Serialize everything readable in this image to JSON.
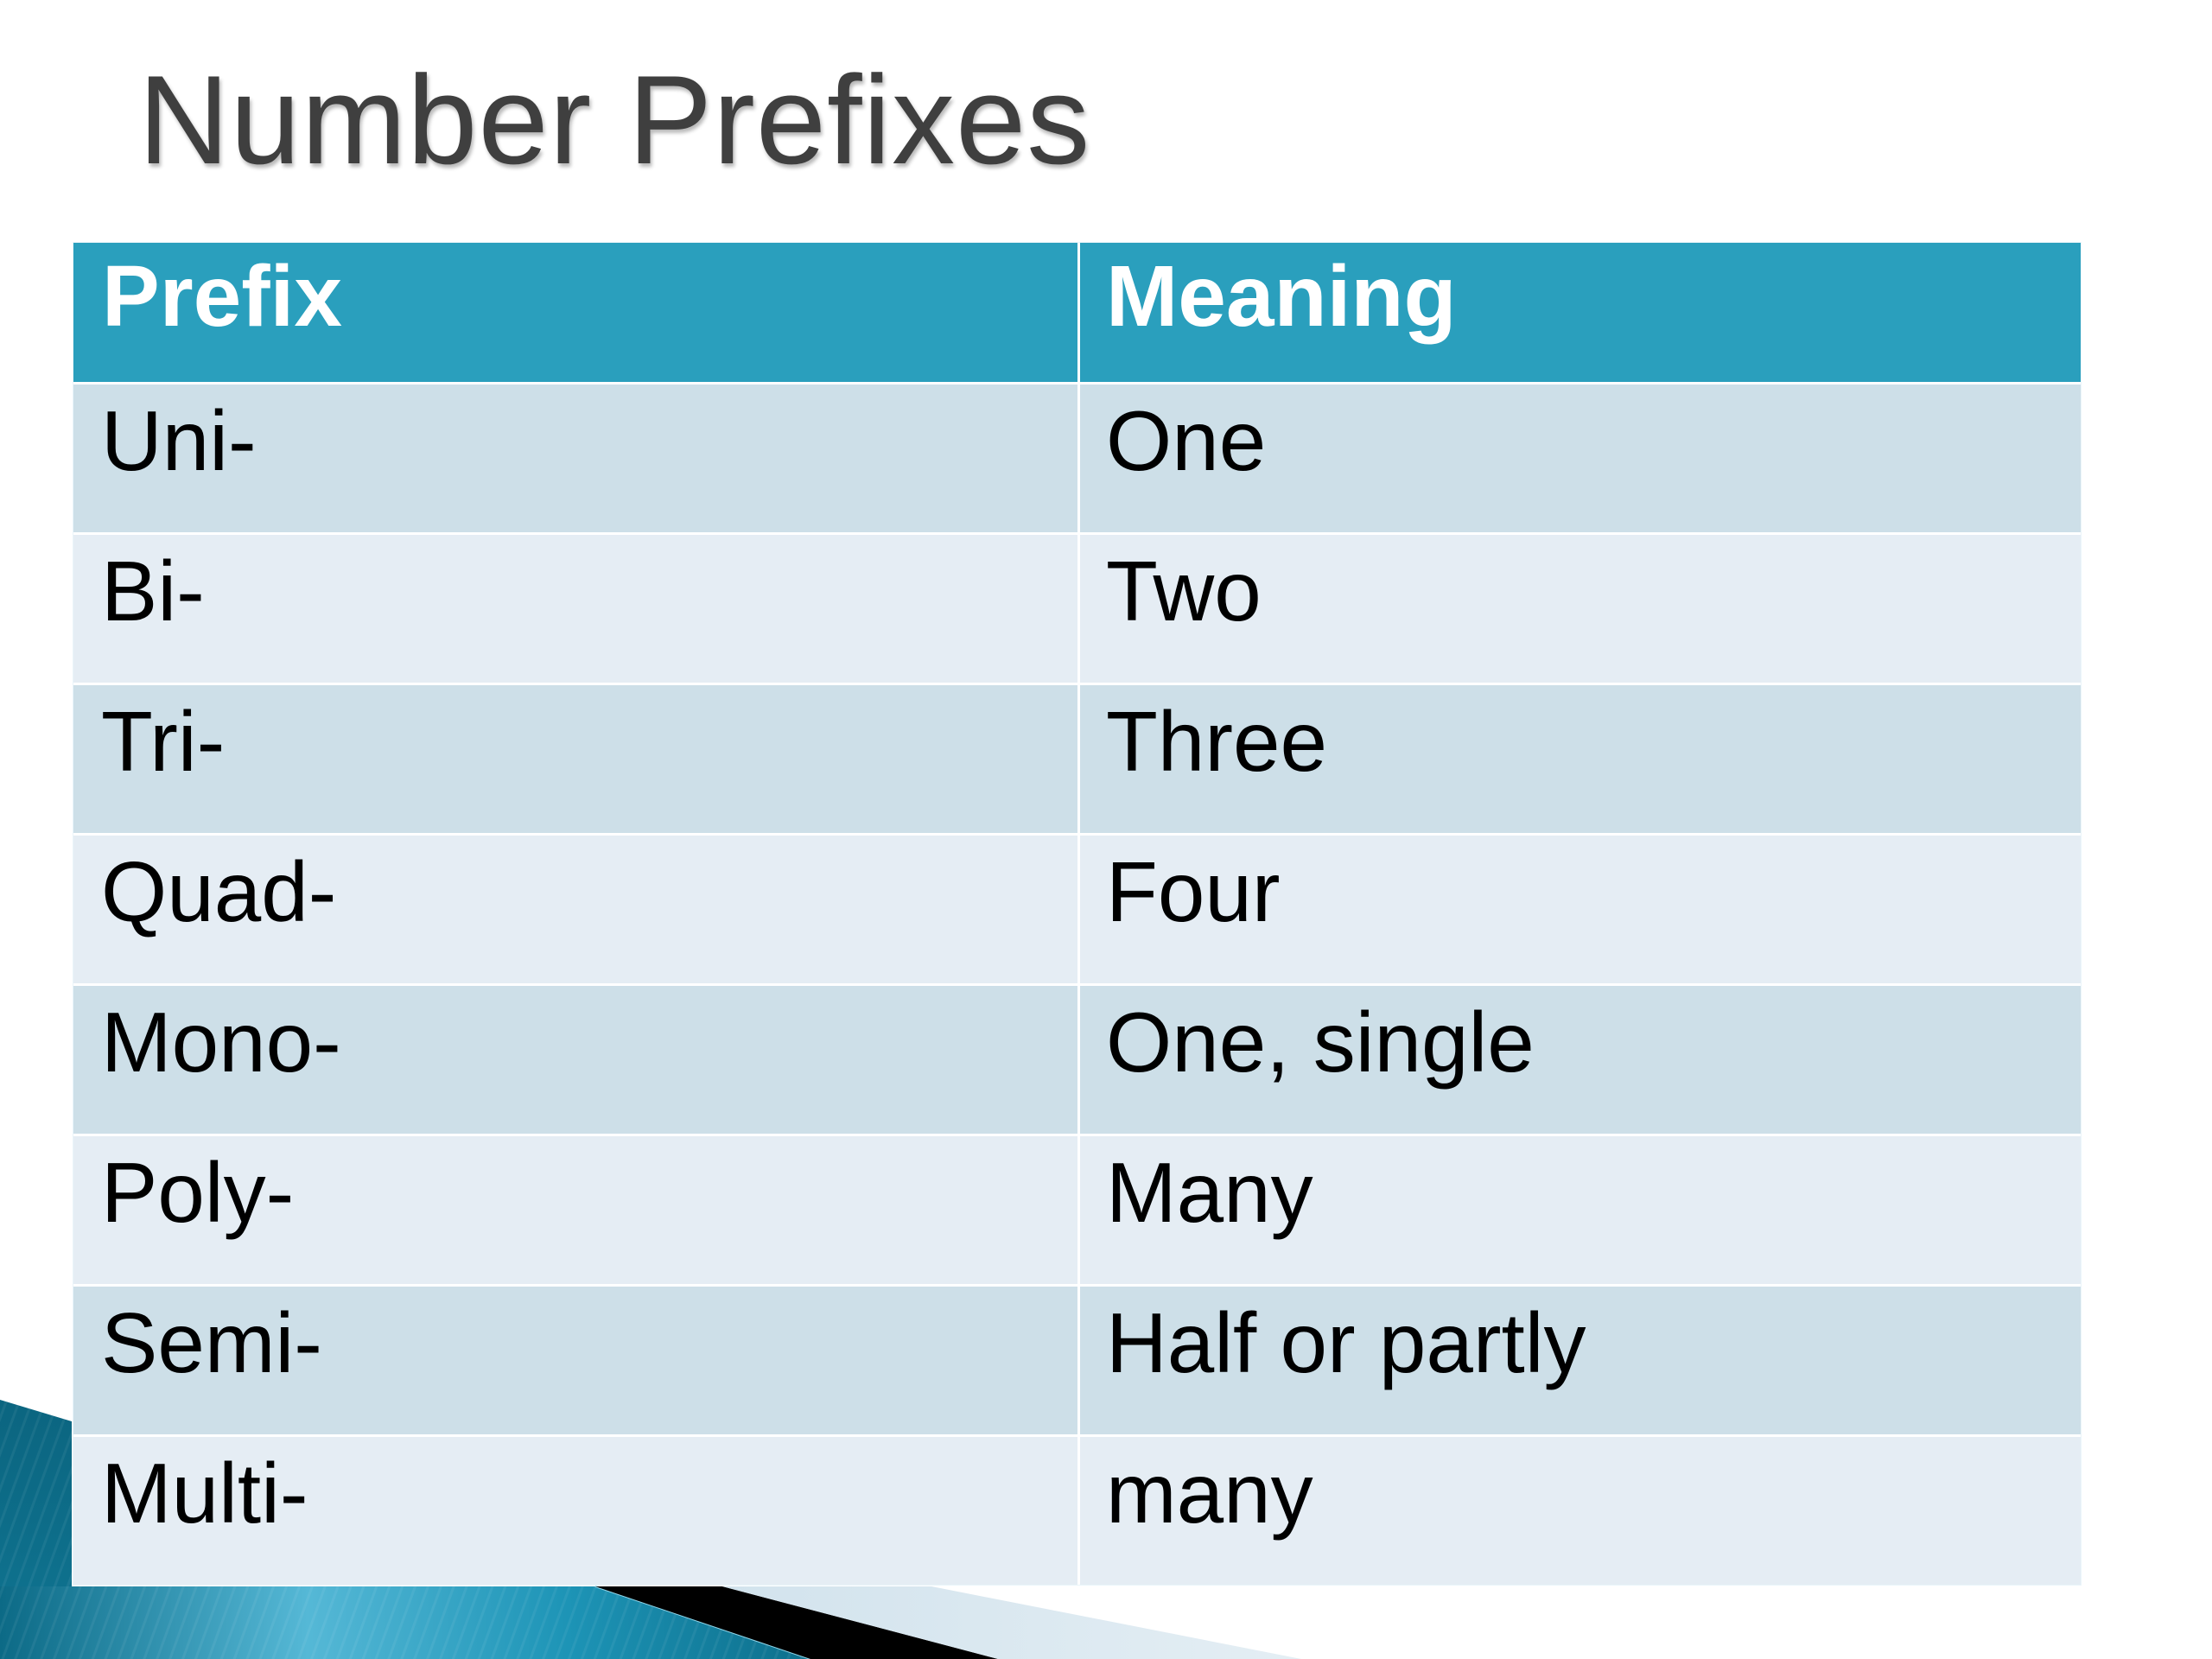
{
  "slide": {
    "title": "Number Prefixes"
  },
  "table": {
    "headers": [
      "Prefix",
      "Meaning"
    ],
    "rows": [
      {
        "prefix": "Uni-",
        "meaning": "One"
      },
      {
        "prefix": "Bi-",
        "meaning": "Two"
      },
      {
        "prefix": "Tri-",
        "meaning": "Three"
      },
      {
        "prefix": "Quad-",
        "meaning": "Four"
      },
      {
        "prefix": "Mono-",
        "meaning": "One, single"
      },
      {
        "prefix": "Poly-",
        "meaning": "Many"
      },
      {
        "prefix": "Semi-",
        "meaning": "Half or partly"
      },
      {
        "prefix": "Multi-",
        "meaning": "many"
      }
    ]
  },
  "theme": {
    "header_color": "#2a9fbd",
    "row_odd_color": "#cddfe8",
    "row_even_color": "#e5edf4",
    "title_color": "#3f3f3f",
    "accent_teal": "#0e6f8a"
  }
}
